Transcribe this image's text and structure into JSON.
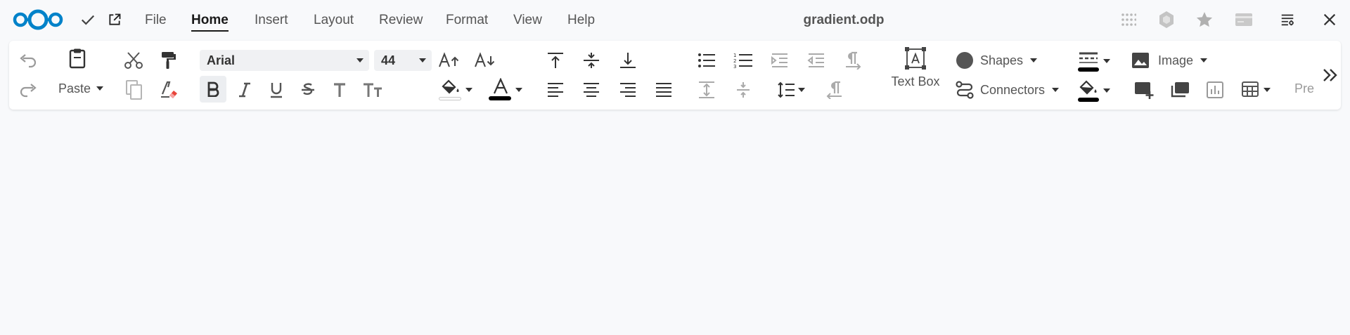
{
  "menu": {
    "items": [
      {
        "id": "file",
        "label": "File"
      },
      {
        "id": "home",
        "label": "Home"
      },
      {
        "id": "insert",
        "label": "Insert"
      },
      {
        "id": "layout",
        "label": "Layout"
      },
      {
        "id": "review",
        "label": "Review"
      },
      {
        "id": "format",
        "label": "Format"
      },
      {
        "id": "view",
        "label": "View"
      },
      {
        "id": "help",
        "label": "Help"
      }
    ],
    "active": "Home"
  },
  "document": {
    "title": "gradient.odp"
  },
  "toolbar": {
    "paste_label": "Paste",
    "font_name": "Arial",
    "font_size": "44",
    "text_box_label": "Text Box",
    "shapes_label": "Shapes",
    "connectors_label": "Connectors",
    "image_label": "Image",
    "truncated_label": "Pre",
    "highlight_color": "#ffffff",
    "font_color": "#000000",
    "line_color": "#000000",
    "fill_color": "#000000"
  },
  "colors": {
    "brand": "#0082c9",
    "accent": "#1a1a1a",
    "background": "#f8f9fb"
  },
  "icons": [
    "nextcloud-logo",
    "checkmark-icon",
    "open-external-icon",
    "undo-icon",
    "redo-icon",
    "clipboard-icon",
    "scissors-icon",
    "copy-icon",
    "paintbrush-icon",
    "clear-formatting-icon",
    "bold-icon",
    "italic-icon",
    "underline-icon",
    "strikethrough-icon",
    "shadow-icon",
    "case-icon",
    "grow-font-icon",
    "shrink-font-icon",
    "highlight-icon",
    "font-color-icon",
    "align-top-icon",
    "align-middle-icon",
    "align-bottom-icon",
    "align-left-icon",
    "align-center-icon",
    "align-right-icon",
    "justify-icon",
    "bullet-list-icon",
    "numbered-list-icon",
    "increase-indent-icon",
    "decrease-indent-icon",
    "pilcrow-ltr-icon",
    "pilcrow-rtl-icon",
    "para-spacing-icon",
    "para-spacing-decrease-icon",
    "line-spacing-icon",
    "text-box-icon",
    "shapes-icon",
    "connectors-icon",
    "line-style-icon",
    "fill-icon",
    "image-icon",
    "new-slide-icon",
    "duplicate-slide-icon",
    "chart-icon",
    "table-icon",
    "more-icon",
    "apps-grid-icon",
    "hexagon-icon",
    "star-icon",
    "card-icon",
    "sidebar-toggle-icon",
    "close-icon"
  ]
}
